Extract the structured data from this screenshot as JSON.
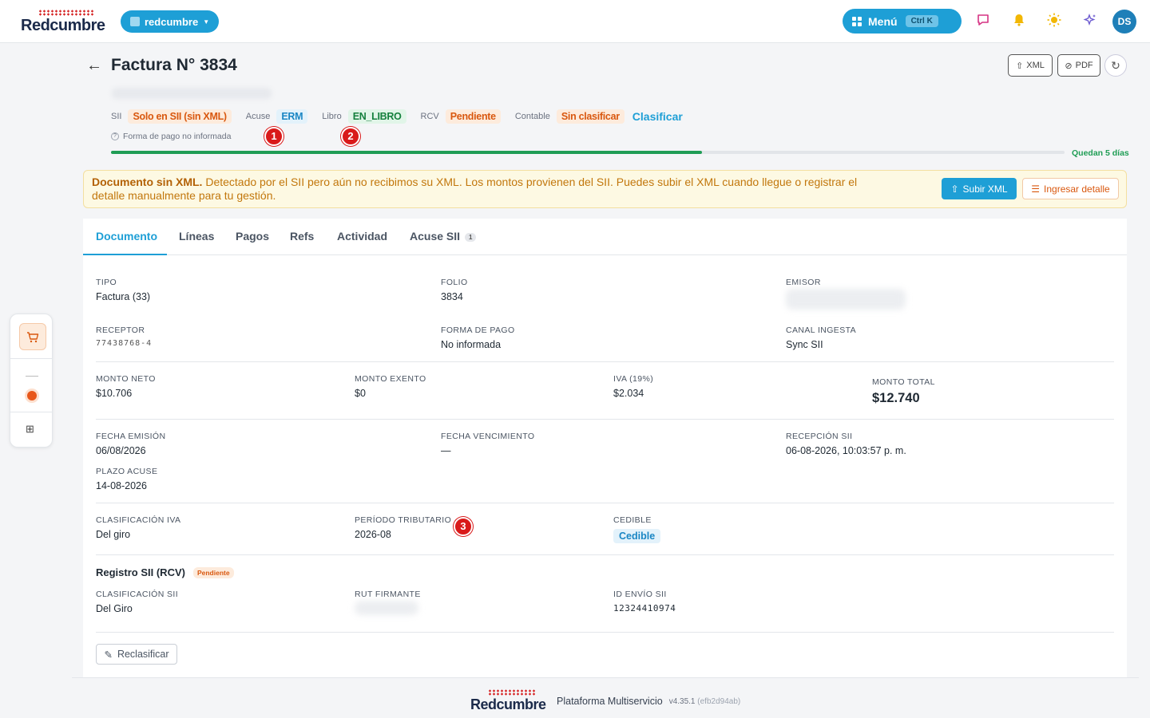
{
  "topbar": {
    "logo_text": "Redcumbre",
    "org_selector": "redcumbre",
    "menu_label": "Menú",
    "menu_shortcut": "Ctrl K",
    "avatar_initials": "DS"
  },
  "header": {
    "title": "Factura N° 3834",
    "xml_button": "XML",
    "pdf_button": "PDF"
  },
  "status": {
    "sii_label": "SII",
    "sii_value": "Solo en SII (sin XML)",
    "acuse_label": "Acuse",
    "acuse_value": "ERM",
    "libro_label": "Libro",
    "libro_value": "EN_LIBRO",
    "rcv_label": "RCV",
    "rcv_value": "Pendiente",
    "contable_label": "Contable",
    "contable_value": "Sin clasificar",
    "clasificar_link": "Clasificar",
    "forma_pago": "Forma de pago no informada",
    "quedan": "Quedan 5 días",
    "progress_fraction": 0.62
  },
  "markers": [
    "1",
    "2",
    "3"
  ],
  "alert": {
    "title": "Documento sin XML.",
    "body": " Detectado por el SII pero aún no recibimos su XML. Los montos provienen del SII. Puedes subir el XML cuando llegue o registrar el detalle manualmente para tu gestión.",
    "subir_button": "Subir XML",
    "ingresar_button": "Ingresar detalle"
  },
  "tabs": [
    {
      "label": "Documento"
    },
    {
      "label": "Líneas"
    },
    {
      "label": "Pagos"
    },
    {
      "label": "Refs"
    },
    {
      "label": "Actividad"
    },
    {
      "label": "Acuse SII",
      "badge": "1"
    }
  ],
  "fields": {
    "tipo": {
      "label": "TIPO",
      "value": "Factura (33)"
    },
    "folio": {
      "label": "FOLIO",
      "value": "3834"
    },
    "emisor": {
      "label": "EMISOR"
    },
    "receptor": {
      "label": "RECEPTOR",
      "value": "77438768-4"
    },
    "forma_pago": {
      "label": "FORMA DE PAGO",
      "value": "No informada"
    },
    "canal": {
      "label": "CANAL INGESTA",
      "value": "Sync SII"
    },
    "neto": {
      "label": "MONTO NETO",
      "value": "$10.706"
    },
    "exento": {
      "label": "MONTO EXENTO",
      "value": "$0"
    },
    "iva": {
      "label": "IVA (19%)",
      "value": "$2.034"
    },
    "total": {
      "label": "MONTO TOTAL",
      "value": "$12.740"
    },
    "fecha_emision": {
      "label": "FECHA EMISIÓN",
      "value": "06/08/2026"
    },
    "fecha_venc": {
      "label": "FECHA VENCIMIENTO",
      "value": "—"
    },
    "recepcion": {
      "label": "RECEPCIÓN SII",
      "value": "06-08-2026, 10:03:57 p. m."
    },
    "plazo": {
      "label": "PLAZO ACUSE",
      "value": "14-08-2026"
    },
    "clasif_iva": {
      "label": "CLASIFICACIÓN IVA",
      "value": "Del giro"
    },
    "periodo": {
      "label": "PERÍODO TRIBUTARIO",
      "value": "2026-08"
    },
    "cedible": {
      "label": "CEDIBLE",
      "value": "Cedible"
    }
  },
  "rcv": {
    "title": "Registro SII (RCV)",
    "badge": "Pendiente",
    "clasif_sii": {
      "label": "CLASIFICACIÓN SII",
      "value": "Del Giro"
    },
    "rut_firmante": {
      "label": "RUT FIRMANTE"
    },
    "id_envio": {
      "label": "ID ENVÍO SII",
      "value": "12324410974"
    },
    "reclasificar_button": "Reclasificar"
  },
  "footer": {
    "logo_text": "Redcumbre",
    "platform": "Plataforma Multiservicio",
    "version": "v4.35.1",
    "hash": "(efb2d94ab)"
  },
  "colors": {
    "accent": "#1e9fd6",
    "warning": "#d9580f",
    "success": "#1f9d55",
    "marker": "#d91a1a"
  }
}
